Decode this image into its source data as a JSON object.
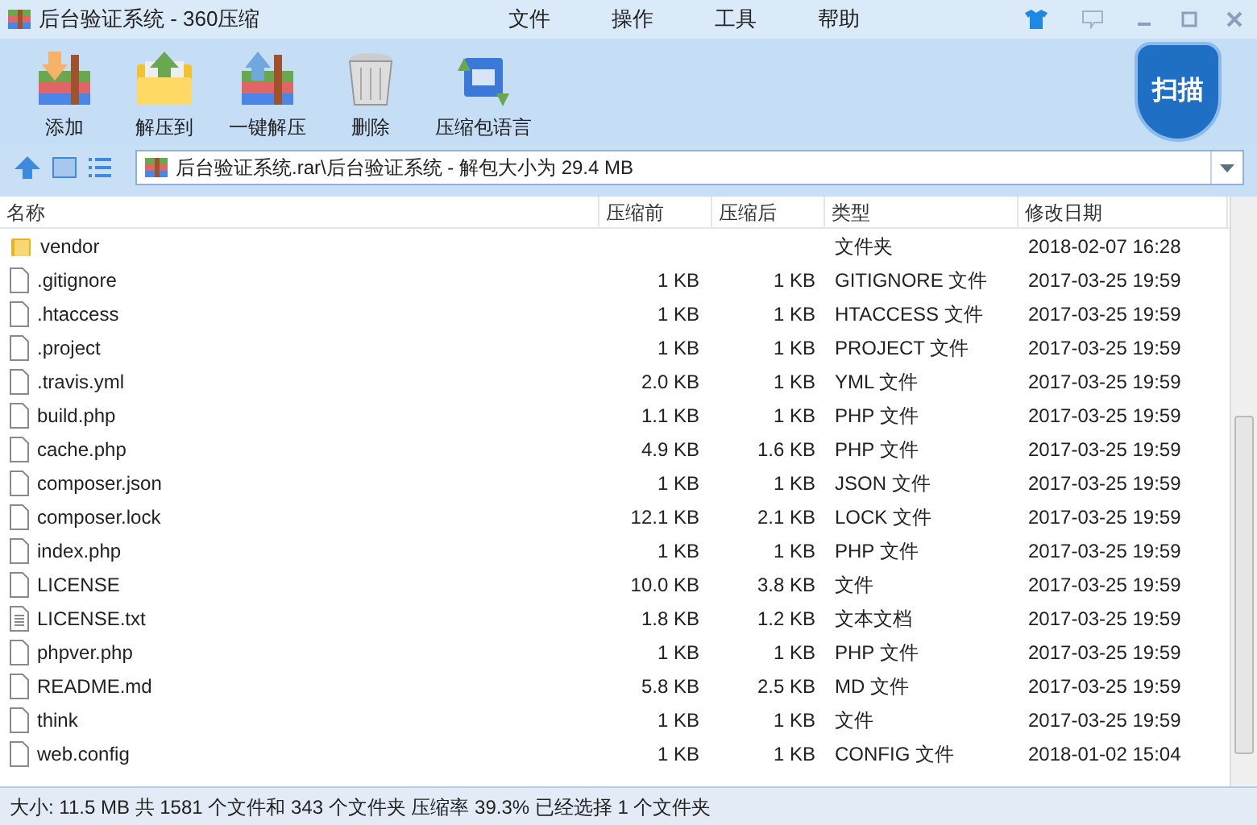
{
  "window": {
    "title": "后台验证系统 - 360压缩"
  },
  "menu": [
    "文件",
    "操作",
    "工具",
    "帮助"
  ],
  "toolbar": [
    {
      "label": "添加",
      "kind": "add"
    },
    {
      "label": "解压到",
      "kind": "extract"
    },
    {
      "label": "一键解压",
      "kind": "quick"
    },
    {
      "label": "删除",
      "kind": "delete"
    },
    {
      "label": "压缩包语言",
      "kind": "lang"
    }
  ],
  "scan_button": "扫描",
  "address": "后台验证系统.rar\\后台验证系统 - 解包大小为 29.4 MB",
  "table": {
    "columns": [
      "名称",
      "压缩前",
      "压缩后",
      "类型",
      "修改日期"
    ],
    "rows": [
      {
        "kind": "folder",
        "name": "vendor",
        "before": "",
        "after": "",
        "type": "文件夹",
        "date": "2018-02-07 16:28"
      },
      {
        "kind": "file",
        "name": ".gitignore",
        "before": "1 KB",
        "after": "1 KB",
        "type": "GITIGNORE 文件",
        "date": "2017-03-25 19:59"
      },
      {
        "kind": "file",
        "name": ".htaccess",
        "before": "1 KB",
        "after": "1 KB",
        "type": "HTACCESS 文件",
        "date": "2017-03-25 19:59"
      },
      {
        "kind": "file",
        "name": ".project",
        "before": "1 KB",
        "after": "1 KB",
        "type": "PROJECT 文件",
        "date": "2017-03-25 19:59"
      },
      {
        "kind": "file",
        "name": ".travis.yml",
        "before": "2.0 KB",
        "after": "1 KB",
        "type": "YML 文件",
        "date": "2017-03-25 19:59"
      },
      {
        "kind": "file",
        "name": "build.php",
        "before": "1.1 KB",
        "after": "1 KB",
        "type": "PHP 文件",
        "date": "2017-03-25 19:59"
      },
      {
        "kind": "file",
        "name": "cache.php",
        "before": "4.9 KB",
        "after": "1.6 KB",
        "type": "PHP 文件",
        "date": "2017-03-25 19:59"
      },
      {
        "kind": "file",
        "name": "composer.json",
        "before": "1 KB",
        "after": "1 KB",
        "type": "JSON 文件",
        "date": "2017-03-25 19:59"
      },
      {
        "kind": "file",
        "name": "composer.lock",
        "before": "12.1 KB",
        "after": "2.1 KB",
        "type": "LOCK 文件",
        "date": "2017-03-25 19:59"
      },
      {
        "kind": "file",
        "name": "index.php",
        "before": "1 KB",
        "after": "1 KB",
        "type": "PHP 文件",
        "date": "2017-03-25 19:59"
      },
      {
        "kind": "file",
        "name": "LICENSE",
        "before": "10.0 KB",
        "after": "3.8 KB",
        "type": "文件",
        "date": "2017-03-25 19:59"
      },
      {
        "kind": "text",
        "name": "LICENSE.txt",
        "before": "1.8 KB",
        "after": "1.2 KB",
        "type": "文本文档",
        "date": "2017-03-25 19:59"
      },
      {
        "kind": "file",
        "name": "phpver.php",
        "before": "1 KB",
        "after": "1 KB",
        "type": "PHP 文件",
        "date": "2017-03-25 19:59"
      },
      {
        "kind": "file",
        "name": "README.md",
        "before": "5.8 KB",
        "after": "2.5 KB",
        "type": "MD 文件",
        "date": "2017-03-25 19:59"
      },
      {
        "kind": "file",
        "name": "think",
        "before": "1 KB",
        "after": "1 KB",
        "type": "文件",
        "date": "2017-03-25 19:59"
      },
      {
        "kind": "file",
        "name": "web.config",
        "before": "1 KB",
        "after": "1 KB",
        "type": "CONFIG 文件",
        "date": "2018-01-02 15:04"
      }
    ]
  },
  "status_bar": "大小: 11.5 MB 共 1581 个文件和 343 个文件夹 压缩率 39.3% 已经选择 1 个文件夹"
}
